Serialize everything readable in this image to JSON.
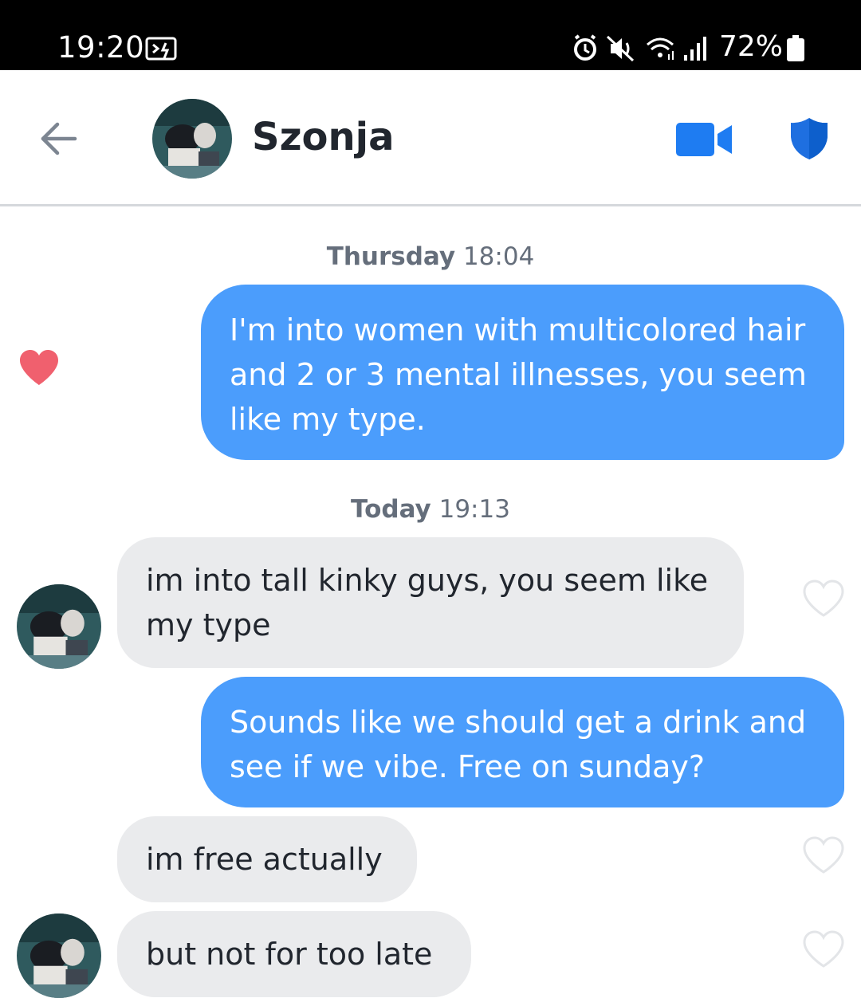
{
  "status_bar": {
    "time": "19:20",
    "battery": "72%",
    "icons": [
      "screen-cast-icon",
      "alarm-icon",
      "mute-icon",
      "wifi-icon",
      "signal-icon",
      "battery-icon"
    ]
  },
  "header": {
    "contact_name": "Szonja",
    "icons": [
      "back-arrow-icon",
      "video-camera-icon",
      "shield-icon"
    ],
    "accent_color": "#1e7cf2"
  },
  "messages": [
    {
      "type": "timestamp",
      "day": "Thursday",
      "time": "18:04"
    },
    {
      "type": "outgoing",
      "text": "I'm into women with multicolored hair and 2 or 3 mental illnesses, you seem like my type.",
      "liked": true
    },
    {
      "type": "timestamp",
      "day": "Today",
      "time": "19:13"
    },
    {
      "type": "incoming",
      "text": "im into tall kinky guys, you seem like my type",
      "liked": false
    },
    {
      "type": "outgoing",
      "text": "Sounds like we should get a drink and see if we vibe. Free on sunday?"
    },
    {
      "type": "incoming",
      "text": "im free actually",
      "liked": false
    },
    {
      "type": "incoming",
      "text": "but not for too late",
      "liked": false
    }
  ],
  "colors": {
    "outgoing_bubble": "#4b9dfc",
    "incoming_bubble": "#eaebed",
    "like_heart": "#f0606e",
    "timestamp_text": "#656e7b"
  }
}
